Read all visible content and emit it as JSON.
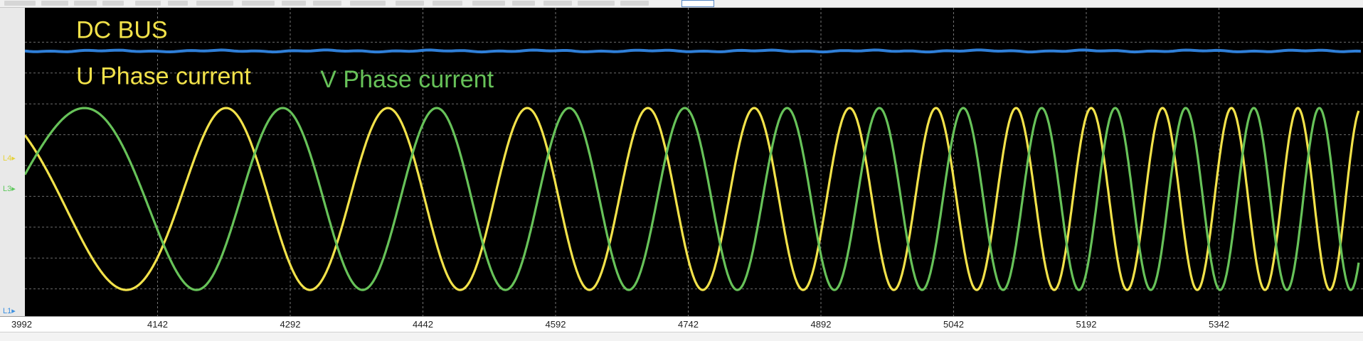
{
  "chart_data": {
    "type": "line",
    "title": "",
    "xlabel": "",
    "ylabel": "",
    "x_ticks": [
      "3992",
      "4142",
      "4292",
      "4442",
      "4592",
      "4742",
      "4892",
      "5042",
      "5192",
      "5342"
    ],
    "xlim": [
      3992,
      5500
    ],
    "ylim": [
      0,
      1
    ],
    "grid": true,
    "background": "#000000",
    "lane_markers": [
      {
        "label": "L4",
        "color": "#e6d23c",
        "y": 0.51
      },
      {
        "label": "L3",
        "color": "#5cc85a",
        "y": 0.41
      },
      {
        "label": "L1",
        "color": "#3b8fe0",
        "y": 0.0
      }
    ],
    "series": [
      {
        "name": "DC BUS",
        "color": "#2f7fd8",
        "kind": "flat",
        "level": 0.86,
        "label_color": "#f2e24a"
      },
      {
        "name": "U Phase current",
        "color": "#f2e24a",
        "kind": "chirp",
        "center": 0.38,
        "amplitude": 0.295,
        "periods": [
          {
            "x": 4000,
            "period": 345
          },
          {
            "x": 4200,
            "period": 200
          },
          {
            "x": 4400,
            "period": 170
          },
          {
            "x": 4600,
            "period": 140
          },
          {
            "x": 4800,
            "period": 115
          },
          {
            "x": 5000,
            "period": 95
          },
          {
            "x": 5200,
            "period": 82
          },
          {
            "x": 5400,
            "period": 75
          },
          {
            "x": 5500,
            "period": 70
          }
        ],
        "phase_deg": 135
      },
      {
        "name": "V Phase current",
        "color": "#67c259",
        "kind": "chirp",
        "center": 0.38,
        "amplitude": 0.295,
        "periods": [
          {
            "x": 4000,
            "period": 345
          },
          {
            "x": 4200,
            "period": 200
          },
          {
            "x": 4400,
            "period": 170
          },
          {
            "x": 4600,
            "period": 140
          },
          {
            "x": 4800,
            "period": 115
          },
          {
            "x": 5000,
            "period": 95
          },
          {
            "x": 5200,
            "period": 82
          },
          {
            "x": 5400,
            "period": 75
          },
          {
            "x": 5500,
            "period": 70
          }
        ],
        "phase_deg": 15
      }
    ],
    "annotations": [
      {
        "text": "DC BUS",
        "color": "#f2e24a",
        "x": 4050,
        "y": 0.93
      },
      {
        "text": "U Phase current",
        "color": "#f2e24a",
        "x": 4050,
        "y": 0.78
      },
      {
        "text": "V Phase current",
        "color": "#67c259",
        "x": 4326,
        "y": 0.77
      }
    ]
  }
}
